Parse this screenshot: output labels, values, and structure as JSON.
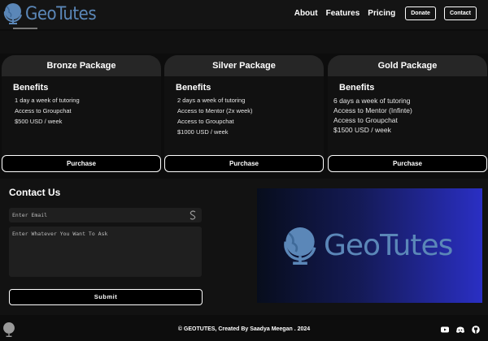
{
  "header": {
    "logo_text": "GeoTutes",
    "nav": [
      "About",
      "Features",
      "Pricing"
    ],
    "donate_label": "Donate",
    "contact_label": "Contact"
  },
  "packages": [
    {
      "title": "Bronze Package",
      "benefits_label": "Benefits",
      "lines": [
        "1 day a week of tutoring",
        "Access to Groupchat",
        "$500 USD / week"
      ],
      "purchase_label": "Purchase"
    },
    {
      "title": "Silver Package",
      "benefits_label": "Benefits",
      "lines": [
        "2 days a week of tutoring",
        "Access to Mentor (2x week)",
        "Access to Groupchat",
        "$1000 USD / week"
      ],
      "purchase_label": "Purchase"
    },
    {
      "title": "Gold Package",
      "benefits_label": "Benefits",
      "lines": [
        "6 days a week of tutoring",
        "Access to Mentor (Infinte)",
        "Access to Groupchat",
        "$1500 USD / week"
      ],
      "purchase_label": "Purchase"
    }
  ],
  "contact": {
    "title": "Contact Us",
    "email_placeholder": "Enter Email",
    "message_placeholder": "Enter Whatever You Want To Ask",
    "submit_label": "Submit",
    "banner_text": "GeoTutes"
  },
  "footer": {
    "credits": "© GEOTUTES, Created By Saadya Meegan . 2024",
    "socials": [
      "youtube-icon",
      "discord-icon",
      "github-icon"
    ]
  },
  "colors": {
    "brand_blue": "#5b87b8",
    "banner_gradient_end": "#2a2fc4"
  }
}
